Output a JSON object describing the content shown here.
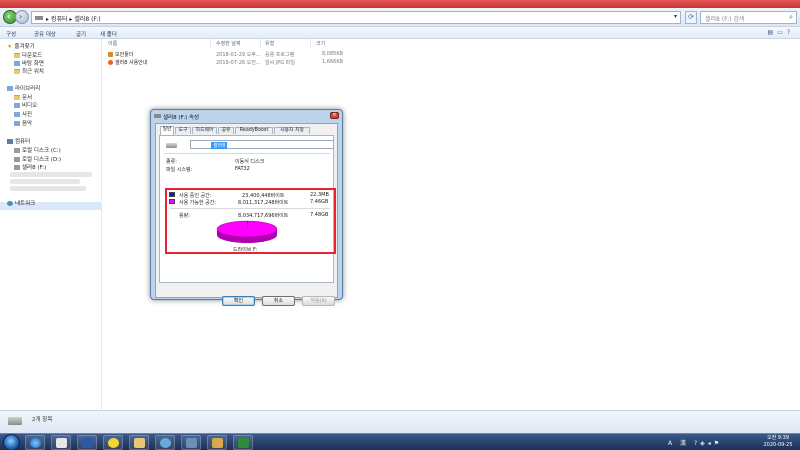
{
  "window": {
    "breadcrumb": [
      "컴퓨터",
      "셀러8 (F:)"
    ],
    "search_placeholder": "셀러8 (F:) 검색"
  },
  "toolbar": {
    "items": [
      "구성",
      "공유 대상",
      "굽기",
      "새 폴더"
    ]
  },
  "nav": {
    "favorites_header": "즐겨찾기",
    "favorites": [
      "다운로드",
      "바탕 화면",
      "최근 위치"
    ],
    "libraries_header": "라이브러리",
    "libraries": [
      "문서",
      "비디오",
      "사진",
      "음악"
    ],
    "computer_header": "컴퓨터",
    "drives": [
      "로컬 디스크 (C:)",
      "로컬 디스크 (D:)",
      "셀러8 (F:)"
    ],
    "network": "네트워크"
  },
  "filelist": {
    "columns": [
      "이름",
      "수정한 날짜",
      "유형",
      "크기"
    ],
    "rows": [
      {
        "name": "보안툴더",
        "modified": "2018-01-29 오후...",
        "type": "응용 프로그램",
        "size": "8,085KB"
      },
      {
        "name": "셀러8 사용안내",
        "modified": "2019-07-26 오전...",
        "type": "알씨 JPG 파일",
        "size": "1,666KB"
      }
    ]
  },
  "status": {
    "item_count": "2개 항목"
  },
  "taskbar": {
    "clock_time": "오전 9:39",
    "clock_date": "2020-09-25",
    "ime": "A 漢",
    "tray_icons": [
      "help-icon",
      "network-icon",
      "volume-icon",
      "flag-icon"
    ]
  },
  "dialog": {
    "title": "셀러8 (F:) 속성",
    "tabs": [
      "일반",
      "도구",
      "하드웨어",
      "공유",
      "ReadyBoost",
      "사용자 지정"
    ],
    "active_tab": "일반",
    "drive_name": "셀러8",
    "type_label": "종류:",
    "type_value": "이동식 디스크",
    "fs_label": "파일 시스템:",
    "fs_value": "FAT32",
    "used_label": "사용 중인 공간:",
    "used_bytes": "23,400,448바이트",
    "used_size": "22.3MB",
    "free_label": "사용 가능한 공간:",
    "free_bytes": "8,011,317,248바이트",
    "free_size": "7.46GB",
    "capacity_label": "용량:",
    "capacity_bytes": "8,034,717,696바이트",
    "capacity_size": "7.48GB",
    "drive_label": "드라이브 F:",
    "used_fraction": 0.003,
    "colors": {
      "used": "#1010e0",
      "free": "#ff00ff",
      "highlight": "#e8242e"
    },
    "buttons": {
      "ok": "확인",
      "cancel": "취소",
      "apply": "적용(A)"
    }
  }
}
